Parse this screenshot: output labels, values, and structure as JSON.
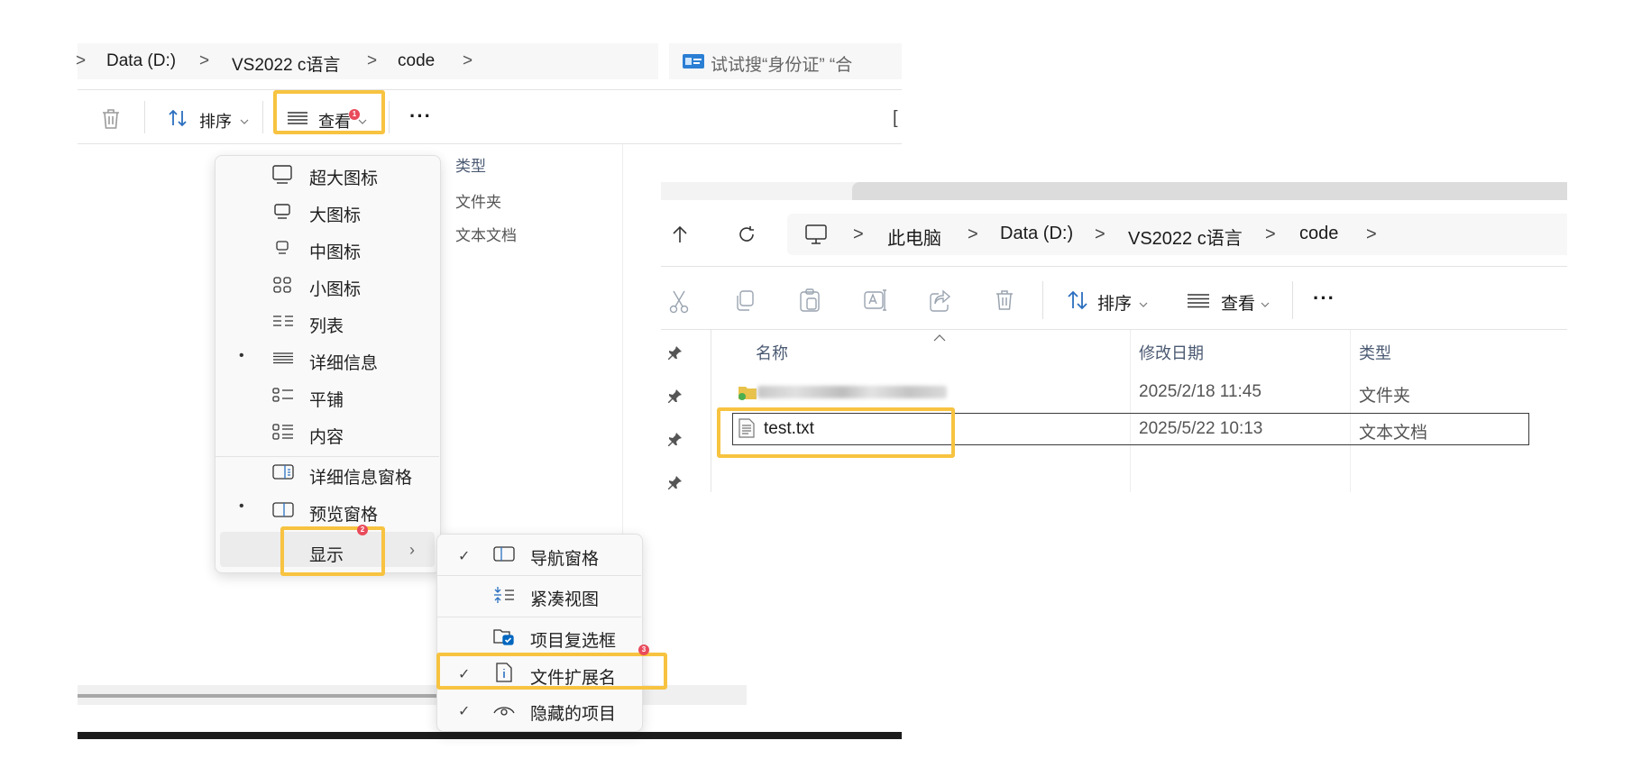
{
  "left": {
    "breadcrumb": [
      ">",
      "Data (D:)",
      ">",
      "VS2022 c语言",
      ">",
      "code",
      ">"
    ],
    "search_placeholder": "试试搜“身份证” “合",
    "toolbar": {
      "sort_label": "排序",
      "view_label": "查看",
      "more_label": "···",
      "clip_char": "["
    },
    "columns": {
      "type": "类型",
      "row1_type": "文件夹",
      "row2_type": "文本文档"
    },
    "view_menu": {
      "items": [
        {
          "label": "超大图标",
          "icon": "monitor-xl-icon",
          "bullet": ""
        },
        {
          "label": "大图标",
          "icon": "monitor-l-icon",
          "bullet": ""
        },
        {
          "label": "中图标",
          "icon": "monitor-m-icon",
          "bullet": ""
        },
        {
          "label": "小图标",
          "icon": "grid-small-icon",
          "bullet": ""
        },
        {
          "label": "列表",
          "icon": "list-icon",
          "bullet": ""
        },
        {
          "label": "详细信息",
          "icon": "details-icon",
          "bullet": "•"
        },
        {
          "label": "平铺",
          "icon": "tiles-icon",
          "bullet": ""
        },
        {
          "label": "内容",
          "icon": "content-icon",
          "bullet": ""
        },
        {
          "label": "详细信息窗格",
          "icon": "details-pane-icon",
          "bullet": ""
        },
        {
          "label": "预览窗格",
          "icon": "preview-pane-icon",
          "bullet": "•"
        }
      ],
      "show_label": "显示",
      "show_arrow": "›"
    },
    "show_menu": {
      "items": [
        {
          "label": "导航窗格",
          "check": "✓",
          "icon": "nav-pane-icon"
        },
        {
          "label": "紧凑视图",
          "check": "",
          "icon": "compact-view-icon"
        },
        {
          "label": "项目复选框",
          "check": "",
          "icon": "item-checkbox-icon"
        },
        {
          "label": "文件扩展名",
          "check": "✓",
          "icon": "file-extension-icon"
        },
        {
          "label": "隐藏的项目",
          "check": "✓",
          "icon": "hidden-items-icon"
        }
      ]
    },
    "badges": {
      "b1": "1",
      "b2": "2",
      "b3": "3"
    },
    "colors": {
      "highlight": "#f7c340",
      "badge": "#e94b5b",
      "accent": "#0067c0"
    }
  },
  "right": {
    "breadcrumb": [
      ">",
      "此电脑",
      ">",
      "Data (D:)",
      ">",
      "VS2022 c语言",
      ">",
      "code",
      ">"
    ],
    "toolbar": {
      "sort_label": "排序",
      "view_label": "查看",
      "more_label": "···"
    },
    "columns": {
      "name": "名称",
      "modified": "修改日期",
      "type": "类型"
    },
    "rows": [
      {
        "name": "",
        "modified": "2025/2/18 11:45",
        "type": "文件夹",
        "blurred": true
      },
      {
        "name": "test.txt",
        "modified": "2025/5/22 10:13",
        "type": "文本文档",
        "blurred": false
      }
    ]
  }
}
